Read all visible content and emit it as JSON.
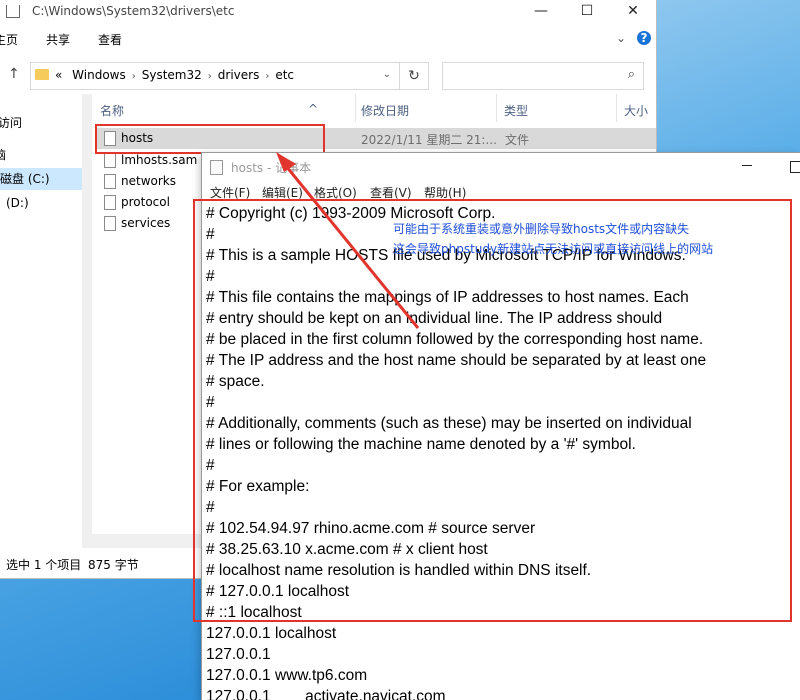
{
  "explorer": {
    "title_path": "C:\\Windows\\System32\\drivers\\etc",
    "window_buttons": [
      "—",
      "☐",
      "✕"
    ],
    "ribbon_tabs": [
      "主页",
      "共享",
      "查看"
    ],
    "address_prefix": "«",
    "breadcrumbs": [
      "Windows",
      "System32",
      "drivers",
      "etc"
    ],
    "nav_items": [
      "访问",
      "脑",
      "磁盘 (C:)",
      "(D:)"
    ],
    "columns": {
      "name": "名称",
      "date": "修改日期",
      "type": "类型",
      "size": "大小"
    },
    "files": [
      {
        "name": "hosts",
        "date": "2022/1/11 星期二 21:...",
        "type": "文件"
      },
      {
        "name": "lmhosts.sam",
        "date": "",
        "type": ""
      },
      {
        "name": "networks",
        "date": "",
        "type": ""
      },
      {
        "name": "protocol",
        "date": "",
        "type": ""
      },
      {
        "name": "services",
        "date": "",
        "type": ""
      }
    ],
    "status_selected": "选中 1 个项目",
    "status_size": "875 字节"
  },
  "notepad": {
    "title": "hosts - 记事本",
    "menu": [
      "文件(F)",
      "编辑(E)",
      "格式(O)",
      "查看(V)",
      "帮助(H)"
    ],
    "lines": [
      "# Copyright (c) 1993-2009 Microsoft Corp.",
      "#",
      "# This is a sample HOSTS file used by Microsoft TCP/IP for Windows.",
      "#",
      "# This file contains the mappings of IP addresses to host names. Each",
      "# entry should be kept on an individual line. The IP address should",
      "# be placed in the first column followed by the corresponding host name.",
      "# The IP address and the host name should be separated by at least one",
      "# space.",
      "#",
      "# Additionally, comments (such as these) may be inserted on individual",
      "# lines or following the machine name denoted by a '#' symbol.",
      "#",
      "# For example:",
      "#",
      "# 102.54.94.97 rhino.acme.com # source server",
      "# 38.25.63.10 x.acme.com # x client host",
      "# localhost name resolution is handled within DNS itself.",
      "# 127.0.0.1 localhost",
      "# ::1 localhost",
      "127.0.0.1 localhost",
      "127.0.0.1",
      "127.0.0.1 www.tp6.com",
      "127.0.0.1        activate.navicat.com"
    ]
  },
  "annotation": {
    "line1": "可能由于系统重装或意外删除导致hosts文件或内容缺失",
    "line2": "这会导致phpstudy新建站点无法访问或直接访问线上的网站",
    "color": "#1f4fd8"
  },
  "colors": {
    "highlight": "#e0342c",
    "selection": "#d9d9d9"
  }
}
